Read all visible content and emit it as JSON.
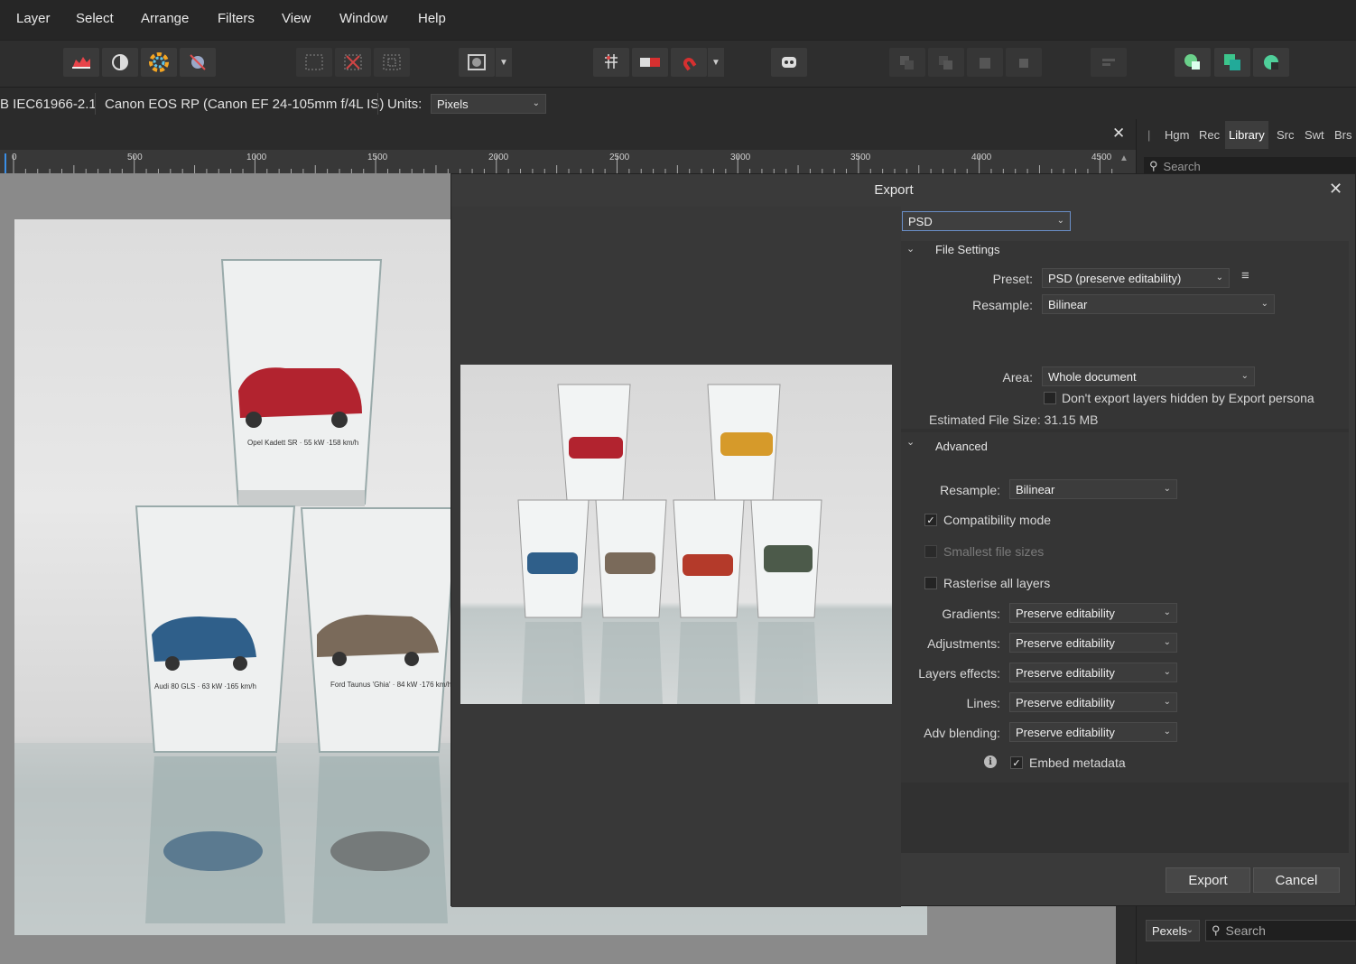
{
  "menu": [
    "Layer",
    "Select",
    "Arrange",
    "Filters",
    "View",
    "Window",
    "Help"
  ],
  "context": {
    "color_profile": "B IEC61966-2.1",
    "camera": "Canon EOS RP (Canon EF 24-105mm f/4L IS)",
    "units_label": "Units:",
    "units_value": "Pixels"
  },
  "ruler_ticks": [
    "0",
    "500",
    "1000",
    "1500",
    "2000",
    "2500",
    "3000",
    "3500",
    "4000",
    "4500"
  ],
  "right_panel": {
    "tabs": [
      "Hgm",
      "Rec",
      "Library",
      "Src",
      "Swt",
      "Brs"
    ],
    "active_tab": "Library",
    "search_placeholder": "Search",
    "bottom_units": "Pexels",
    "bottom_search_placeholder": "Search"
  },
  "export_dialog": {
    "title": "Export",
    "format": "PSD",
    "file_settings": {
      "header": "File Settings",
      "preset_label": "Preset:",
      "preset_value": "PSD (preserve editability)",
      "resample_label": "Resample:",
      "resample_value": "Bilinear",
      "area_label": "Area:",
      "area_value": "Whole document",
      "hidden_layers_label": "Don't export layers hidden by Export persona",
      "hidden_layers_checked": false,
      "estimated_size": "Estimated File Size: 31.15 MB"
    },
    "advanced": {
      "header": "Advanced",
      "resample_label": "Resample:",
      "resample_value": "Bilinear",
      "compatibility_label": "Compatibility mode",
      "compatibility_checked": true,
      "smallest_label": "Smallest file sizes",
      "smallest_checked": false,
      "rasterise_label": "Rasterise all layers",
      "rasterise_checked": false,
      "rows": [
        {
          "label": "Gradients:",
          "value": "Preserve editability"
        },
        {
          "label": "Adjustments:",
          "value": "Preserve editability"
        },
        {
          "label": "Layers effects:",
          "value": "Preserve editability"
        },
        {
          "label": "Lines:",
          "value": "Preserve editability"
        },
        {
          "label": "Adv blending:",
          "value": "Preserve editability"
        }
      ],
      "embed_metadata_label": "Embed metadata",
      "embed_metadata_checked": true
    },
    "export_button": "Export",
    "cancel_button": "Cancel"
  },
  "photo_captions": {
    "top_glass": "Opel Kadett SR · 55 kW ·158 km/h",
    "left_glass": "Audi 80 GLS · 63 kW ·165 km/h",
    "right_glass": "Ford Taunus 'Ghia' · 84 kW ·176 km/h"
  }
}
